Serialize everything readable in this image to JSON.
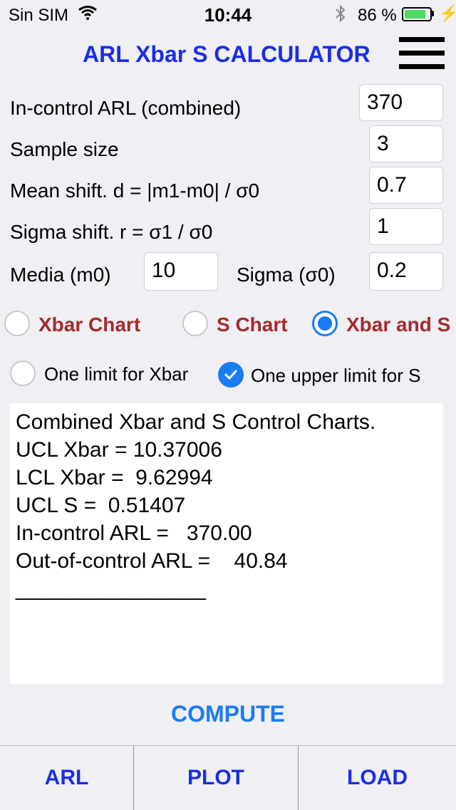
{
  "status_bar": {
    "carrier": "Sin SIM",
    "time": "10:44",
    "battery_pct": "86 %",
    "battery_level": 0.86
  },
  "header": {
    "title": "ARL Xbar S CALCULATOR"
  },
  "form": {
    "arl_label": "In-control ARL (combined)",
    "arl_value": "370",
    "n_label": "Sample size",
    "n_value": "3",
    "d_label": "Mean shift. d = |m1-m0| / σ0",
    "d_value": "0.7",
    "r_label": "Sigma shift. r = σ1 / σ0",
    "r_value": "1",
    "m0_label": "Media (m0)",
    "m0_value": "10",
    "s0_label": "Sigma (σ0)",
    "s0_value": "0.2"
  },
  "chart_type": {
    "options": [
      "Xbar Chart",
      "S Chart",
      "Xbar and S"
    ],
    "selected": "Xbar and S"
  },
  "limits": {
    "one_limit_xbar": {
      "label": "One limit for Xbar",
      "checked": false
    },
    "one_upper_s": {
      "label": "One upper limit for S",
      "checked": true
    }
  },
  "output": {
    "lines": [
      "Combined Xbar and S Control Charts.",
      "UCL Xbar = 10.37006",
      "LCL Xbar =  9.62994",
      "UCL S =  0.51407",
      "In-control ARL =   370.00",
      "Out-of-control ARL =    40.84",
      "________________"
    ]
  },
  "compute_label": "COMPUTE",
  "tabs": [
    "ARL",
    "PLOT",
    "LOAD"
  ],
  "colors": {
    "accent": "#1a7cf5",
    "title_blue": "#1a2ee6",
    "radio_label": "#a52a2a",
    "battery": "#4cd964"
  }
}
